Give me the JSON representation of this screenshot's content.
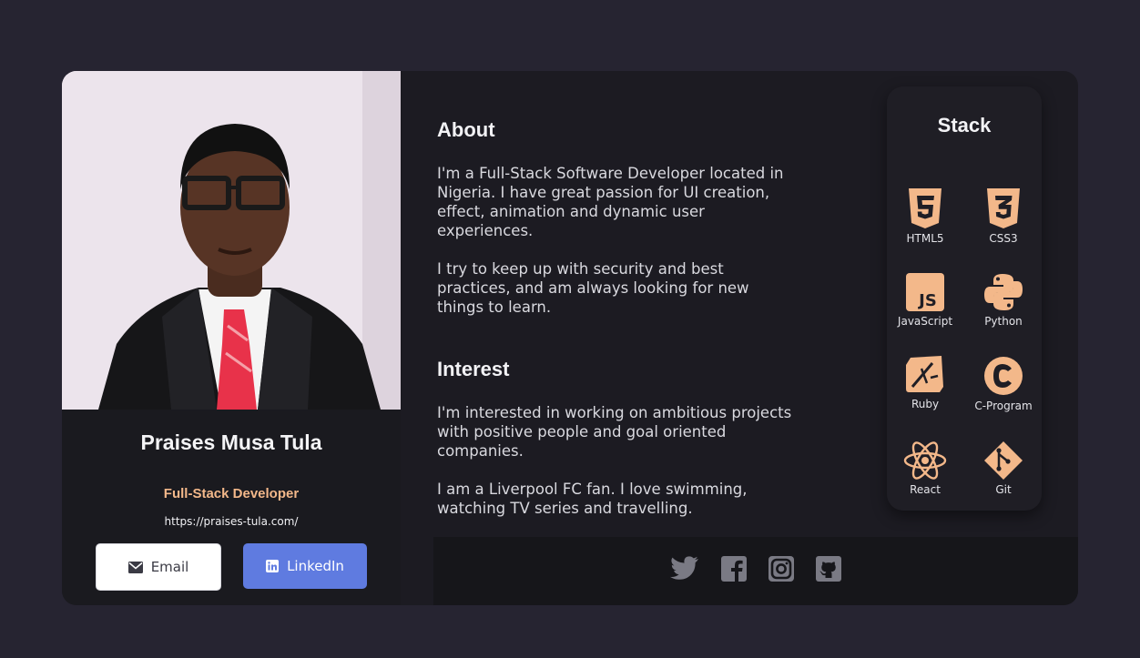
{
  "profile": {
    "name": "Praises Musa Tula",
    "role": "Full-Stack Developer",
    "url": "https://praises-tula.com/",
    "email_label": "Email",
    "linkedin_label": "LinkedIn"
  },
  "about": {
    "title": "About",
    "p1": "I'm a Full-Stack Software Developer located in Nigeria. I have great passion for UI creation, effect, animation and dynamic user experiences.",
    "p2": "I try to keep up with security and best practices, and am always looking for new things to learn."
  },
  "interest": {
    "title": "Interest",
    "p1": "I'm interested in working on ambitious projects with positive people and goal oriented companies.",
    "p2": "I am a Liverpool FC fan. I love swimming, watching TV series and travelling."
  },
  "stack": {
    "title": "Stack",
    "items": [
      {
        "label": "HTML5",
        "icon": "html5-icon"
      },
      {
        "label": "CSS3",
        "icon": "css3-icon"
      },
      {
        "label": "JavaScript",
        "icon": "javascript-icon"
      },
      {
        "label": "Python",
        "icon": "python-icon"
      },
      {
        "label": "Ruby",
        "icon": "ruby-icon"
      },
      {
        "label": "C-Program",
        "icon": "c-program-icon"
      },
      {
        "label": "React",
        "icon": "react-icon"
      },
      {
        "label": "Git",
        "icon": "git-icon"
      }
    ]
  },
  "footer": {
    "icons": [
      "twitter-icon",
      "facebook-icon",
      "instagram-icon",
      "github-icon"
    ]
  },
  "colors": {
    "accent": "#f3b88a",
    "linkedin": "#5f7be0",
    "background": "#262431",
    "card": "#1c1b22"
  }
}
